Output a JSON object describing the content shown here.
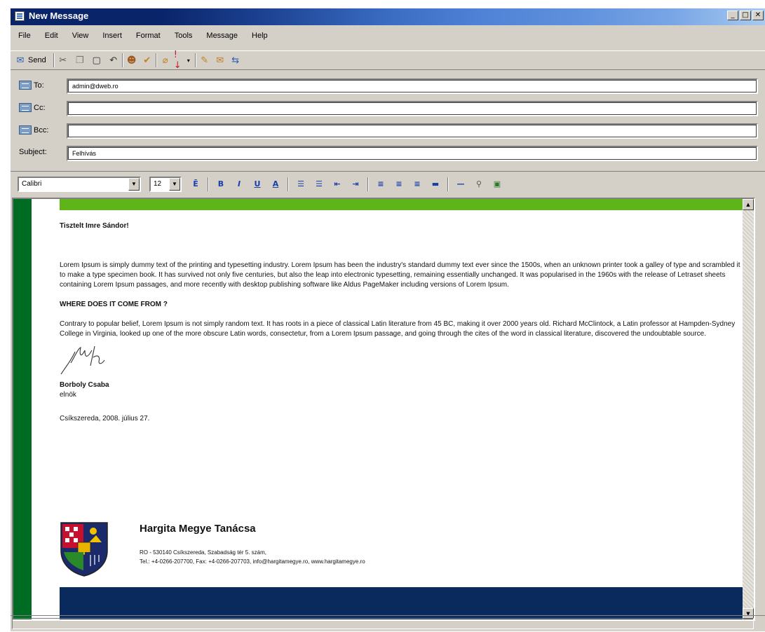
{
  "window": {
    "title": "New Message",
    "controls": [
      "minimize",
      "maximize",
      "close"
    ]
  },
  "menu": [
    {
      "label": "File",
      "mnemonic": "F"
    },
    {
      "label": "Edit",
      "mnemonic": "E"
    },
    {
      "label": "View",
      "mnemonic": "V"
    },
    {
      "label": "Insert",
      "mnemonic": "I"
    },
    {
      "label": "Format",
      "mnemonic": "o"
    },
    {
      "label": "Tools",
      "mnemonic": "T"
    },
    {
      "label": "Message",
      "mnemonic": "M"
    },
    {
      "label": "Help",
      "mnemonic": "H"
    }
  ],
  "toolbar": {
    "send_label": "Send",
    "icons": [
      "cut-icon",
      "copy-icon",
      "paste-icon",
      "undo-icon",
      "check-names-icon",
      "spelling-icon",
      "attach-icon",
      "priority-icon",
      "sign-icon",
      "encrypt-icon",
      "offline-icon"
    ]
  },
  "headers": {
    "to_label": "To:",
    "to_value": "admin@dweb.ro",
    "cc_label": "Cc:",
    "cc_value": "",
    "bcc_label": "Bcc:",
    "bcc_value": "",
    "subject_label": "Subject:",
    "subject_value": "Felhívás"
  },
  "format": {
    "font": "Calibri",
    "size": "12",
    "icons": [
      "paragraph-style-icon",
      "bold-icon",
      "italic-icon",
      "underline-icon",
      "font-color-icon",
      "numbering-icon",
      "bullets-icon",
      "decrease-indent-icon",
      "increase-indent-icon",
      "align-left-icon",
      "align-center-icon",
      "align-right-icon",
      "justify-icon",
      "horizontal-line-icon",
      "hyperlink-icon",
      "insert-picture-icon"
    ]
  },
  "body": {
    "greeting": "Tisztelt Imre Sándor!",
    "paragraph1": "Lorem Ipsum is simply dummy text of the printing and typesetting industry. Lorem Ipsum has been the industry's standard dummy text ever since the 1500s, when an unknown printer took a galley of type and scrambled it to make a type specimen book. It has survived not only five centuries, but also the leap into electronic typesetting, remaining essentially unchanged. It was popularised in the 1960s with the release of Letraset sheets containing Lorem Ipsum passages, and more recently with desktop publishing software like Aldus PageMaker including versions of Lorem Ipsum.",
    "heading": "WHERE DOES IT COME FROM ?",
    "paragraph2": "Contrary to popular belief, Lorem Ipsum is not simply random text. It has roots in a piece of classical Latin literature from 45 BC, making it over 2000 years old. Richard McClintock, a Latin professor at Hampden-Sydney College in Virginia, looked up one of the more obscure Latin words, consectetur, from a Lorem Ipsum passage, and going through the cites of the word in classical literature, discovered the undoubtable source.",
    "signer_name": "Borboly Csaba",
    "signer_title": "elnök",
    "place_date": "Csíkszereda, 2008. július 27."
  },
  "footer": {
    "org_name": "Hargita Megye Tanácsa",
    "address": "RO - 530140 Csíkszereda, Szabadság tér 5. szám,",
    "contact": "Tel.: +4-0266-207700, Fax: +4-0266-207703, info@hargitamegye.ro, www.hargitamegye.ro"
  },
  "colors": {
    "green_stripe": "#006b23",
    "green_top_bar": "#5fb41a",
    "navy_bar": "#0a2a5e"
  }
}
